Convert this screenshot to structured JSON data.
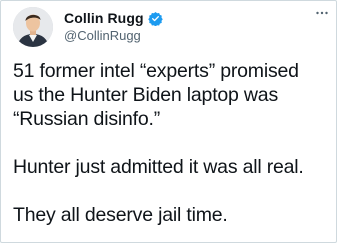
{
  "author": {
    "display_name": "Collin Rugg",
    "handle": "@CollinRugg",
    "verified": true,
    "avatar_icon": "person-avatar-icon"
  },
  "actions": {
    "more_icon": "more-horizontal-icon"
  },
  "tweet": {
    "lines": [
      "51 former intel “experts” promised",
      "us the Hunter Biden laptop was",
      "“Russian disinfo.”",
      "Hunter just admitted it was all real.",
      "They all deserve jail time."
    ]
  },
  "colors": {
    "verified_blue": "#1d9bf0",
    "text_primary": "#0f1419",
    "text_secondary": "#536471",
    "border": "#cfd9de"
  }
}
